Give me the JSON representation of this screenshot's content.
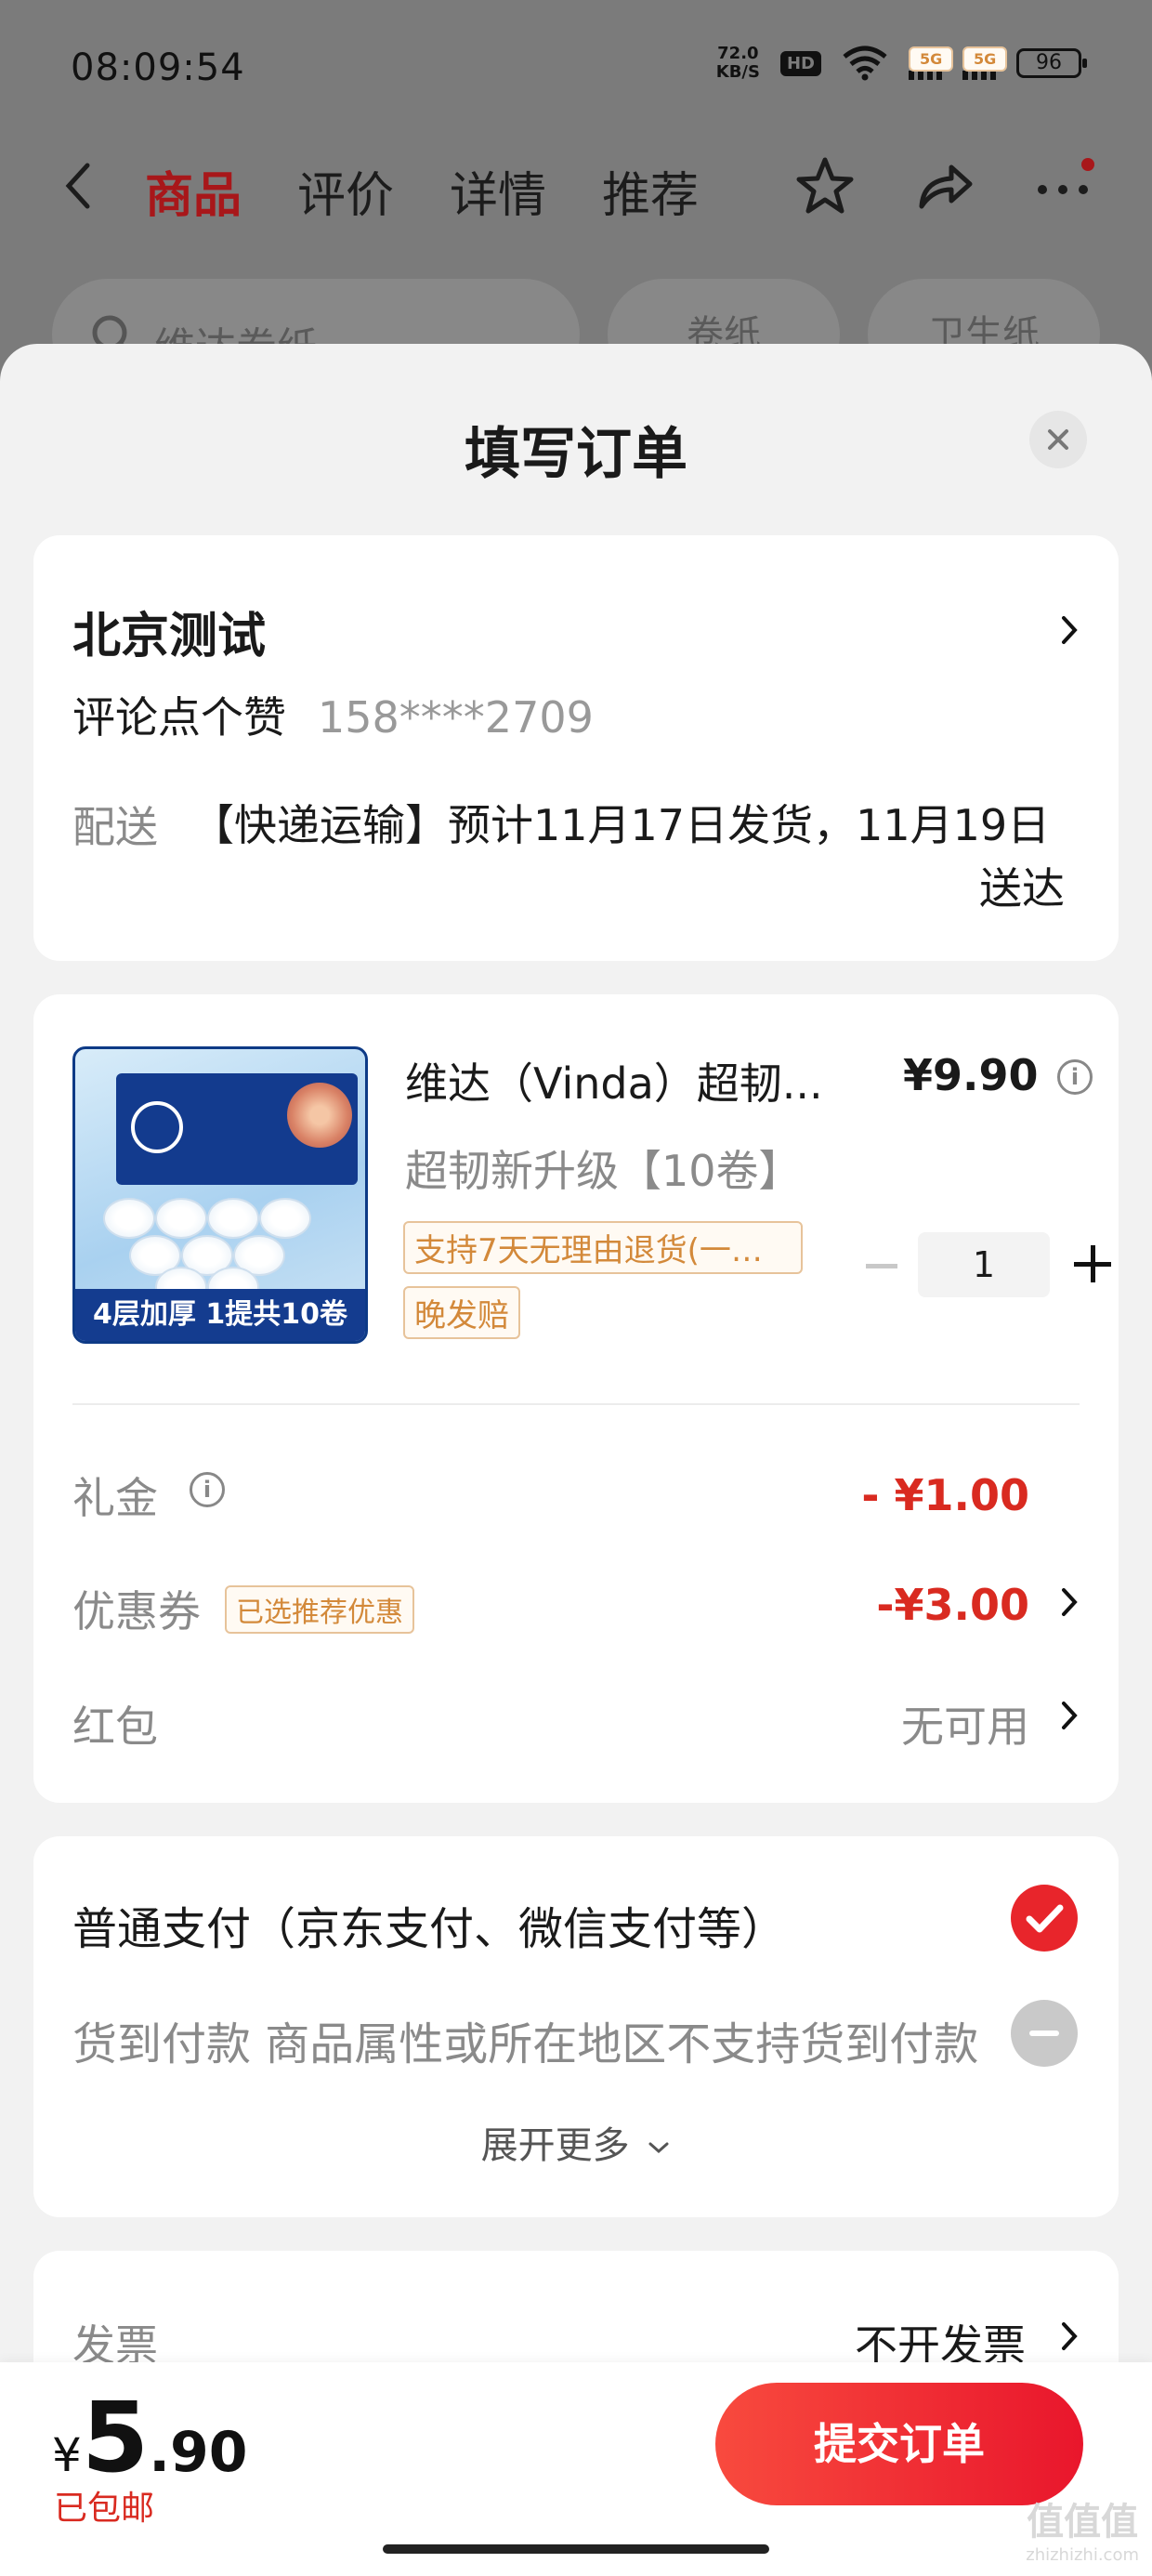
{
  "status_bar": {
    "time": "08:09:54",
    "net_speed_value": "72.0",
    "net_speed_unit": "KB/S",
    "hd_label": "HD",
    "signal1_label": "5G",
    "signal2_label": "5G",
    "battery": "96"
  },
  "nav": {
    "tabs": [
      {
        "label": "商品",
        "active": true
      },
      {
        "label": "评价",
        "active": false
      },
      {
        "label": "详情",
        "active": false
      },
      {
        "label": "推荐",
        "active": false
      }
    ],
    "icons": [
      "back-icon",
      "star-icon",
      "share-icon",
      "more-icon"
    ]
  },
  "background_search": {
    "placeholder": "维达卷纸",
    "chips": [
      "卷纸",
      "卫生纸"
    ]
  },
  "sheet": {
    "title": "填写订单"
  },
  "address": {
    "name": "北京测试",
    "recipient": "评论点个赞",
    "phone": "158****2709",
    "delivery_label": "配送",
    "delivery_line1": "【快递运输】预计11月17日发货，11月19日",
    "delivery_line2": "送达"
  },
  "product": {
    "image_banner": "4层加厚  1提共10卷",
    "name": "维达（Vinda）超韧...",
    "price": "¥9.90",
    "spec": "超韧新升级【10卷】",
    "tag_return": "支持7天无理由退货(一次...",
    "tag_late": "晚发赔",
    "quantity": "1"
  },
  "discounts": {
    "gift_label": "礼金",
    "gift_value": "- ¥1.00",
    "coupon_label": "优惠券",
    "coupon_tag": "已选推荐优惠",
    "coupon_value": "-¥3.00",
    "redpacket_label": "红包",
    "redpacket_value": "无可用"
  },
  "payment": {
    "normal": "普通支付（京东支付、微信支付等）",
    "cod": "货到付款 商品属性或所在地区不支持货到付款",
    "expand": "展开更多"
  },
  "invoice": {
    "label": "发票",
    "value": "不开发票"
  },
  "bottom": {
    "currency": "¥",
    "total_int": "5",
    "total_dec": ".90",
    "shipping": "已包邮",
    "submit": "提交订单"
  },
  "watermark": {
    "text": "值值值",
    "sub": "zhizhizhi.com"
  },
  "colors": {
    "accent_red": "#d92a20",
    "nav_active": "#a8171a",
    "tag_orange": "#d3893a"
  }
}
